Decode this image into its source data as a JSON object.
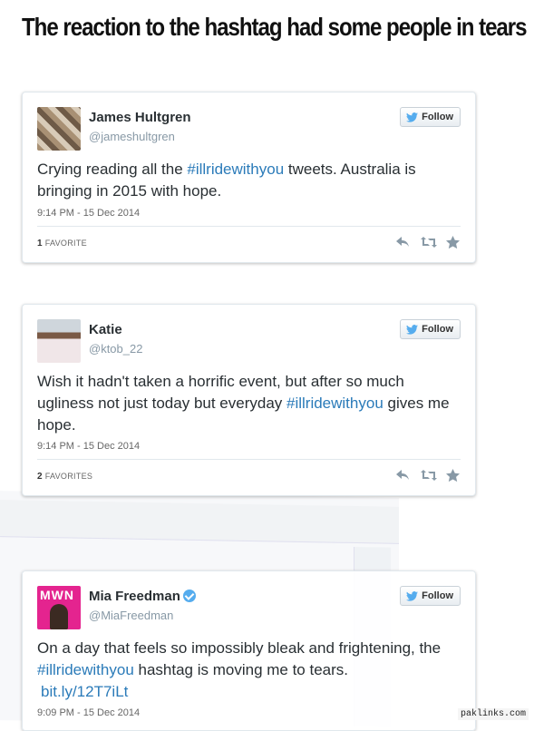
{
  "headline": "The reaction to the hashtag had some people in tears",
  "follow_label": "Follow",
  "tweets": [
    {
      "name": "James Hultgren",
      "handle": "@jameshultgren",
      "text_before": "Crying reading all the ",
      "hashtag": "#illridewithyou",
      "text_after": " tweets. Australia is bringing in 2015 with hope.",
      "time": "9:14 PM - 15 Dec 2014",
      "fav_count": "1",
      "fav_label": "FAVORITE"
    },
    {
      "name": "Katie",
      "handle": "@ktob_22",
      "text_before": "Wish it hadn't taken a horrific event, but after so much ugliness not just today but everyday ",
      "hashtag": "#illridewithyou",
      "text_after": " gives me hope.",
      "time": "9:14 PM - 15 Dec 2014",
      "fav_count": "2",
      "fav_label": "FAVORITES"
    },
    {
      "name": "Mia Freedman",
      "handle": "@MiaFreedman",
      "avatar_text": "MWN",
      "text_before": "On a day that feels so impossibly bleak and frightening, the ",
      "hashtag": "#illridewithyou",
      "text_after": " hashtag is moving me to tears.",
      "link": "bit.ly/12T7iLt",
      "time": "9:09 PM - 15 Dec 2014"
    }
  ],
  "watermark": "paklinks.com",
  "colors": {
    "twitter_blue": "#2b7bb9",
    "verified": "#55acee",
    "mwn_pink": "#e4248f"
  }
}
